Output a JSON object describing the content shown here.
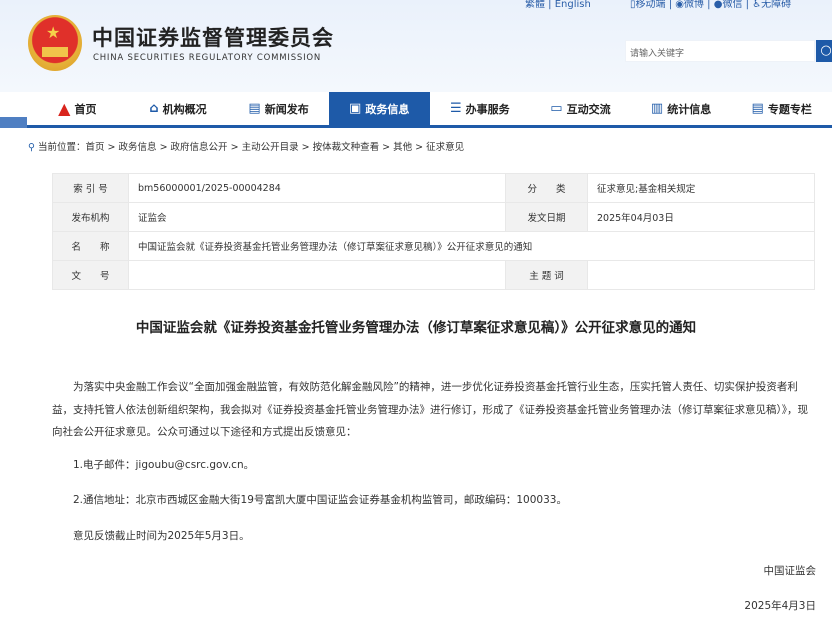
{
  "top_links": {
    "left": [
      "繁體",
      "English"
    ],
    "right": [
      "移动端",
      "微博",
      "微信",
      "无障碍"
    ]
  },
  "logo": {
    "cn": "中国证券监督管理委员会",
    "en": "CHINA SECURITIES REGULATORY COMMISSION"
  },
  "search": {
    "placeholder": "请输入关键字"
  },
  "nav": [
    {
      "label": "首页",
      "icon": "home-logo-icon"
    },
    {
      "label": "机构概况",
      "icon": "building-icon"
    },
    {
      "label": "新闻发布",
      "icon": "news-icon"
    },
    {
      "label": "政务信息",
      "icon": "monitor-icon",
      "active": true
    },
    {
      "label": "办事服务",
      "icon": "form-icon"
    },
    {
      "label": "互动交流",
      "icon": "chat-icon"
    },
    {
      "label": "统计信息",
      "icon": "bar-chart-icon"
    },
    {
      "label": "专题专栏",
      "icon": "document-icon"
    }
  ],
  "breadcrumb": {
    "prefix": "当前位置：",
    "items": [
      "首页",
      "政务信息",
      "政府信息公开",
      "主动公开目录",
      "按体裁文种查看",
      "其他",
      "征求意见"
    ]
  },
  "meta": {
    "index_label": "索 引 号",
    "index": "bm56000001/2025-00004284",
    "category_label": "分　　类",
    "category": "征求意见;基金相关规定",
    "publisher_label": "发布机构",
    "publisher": "证监会",
    "date_label": "发文日期",
    "date": "2025年04月03日",
    "name_label": "名　　称",
    "name": "中国证监会就《证券投资基金托管业务管理办法（修订草案征求意见稿）》公开征求意见的通知",
    "docno_label": "文　　号",
    "docno": "",
    "subject_label": "主 题 词",
    "subject": ""
  },
  "article": {
    "title": "中国证监会就《证券投资基金托管业务管理办法（修订草案征求意见稿）》公开征求意见的通知",
    "paragraphs": [
      "为落实中央金融工作会议“全面加强金融监管，有效防范化解金融风险”的精神，进一步优化证券投资基金托管行业生态，压实托管人责任、切实保护投资者利益，支持托管人依法创新组织架构，我会拟对《证券投资基金托管业务管理办法》进行修订，形成了《证券投资基金托管业务管理办法（修订草案征求意见稿）》，现向社会公开征求意见。公众可通过以下途径和方式提出反馈意见：",
      "1.电子邮件：jigoubu@csrc.gov.cn。",
      "2.通信地址：北京市西城区金融大街19号富凯大厦中国证监会证券基金机构监管司，邮政编码：100033。",
      "意见反馈截止时间为2025年5月3日。"
    ],
    "signer": "中国证监会",
    "sign_date": "2025年4月3日"
  }
}
